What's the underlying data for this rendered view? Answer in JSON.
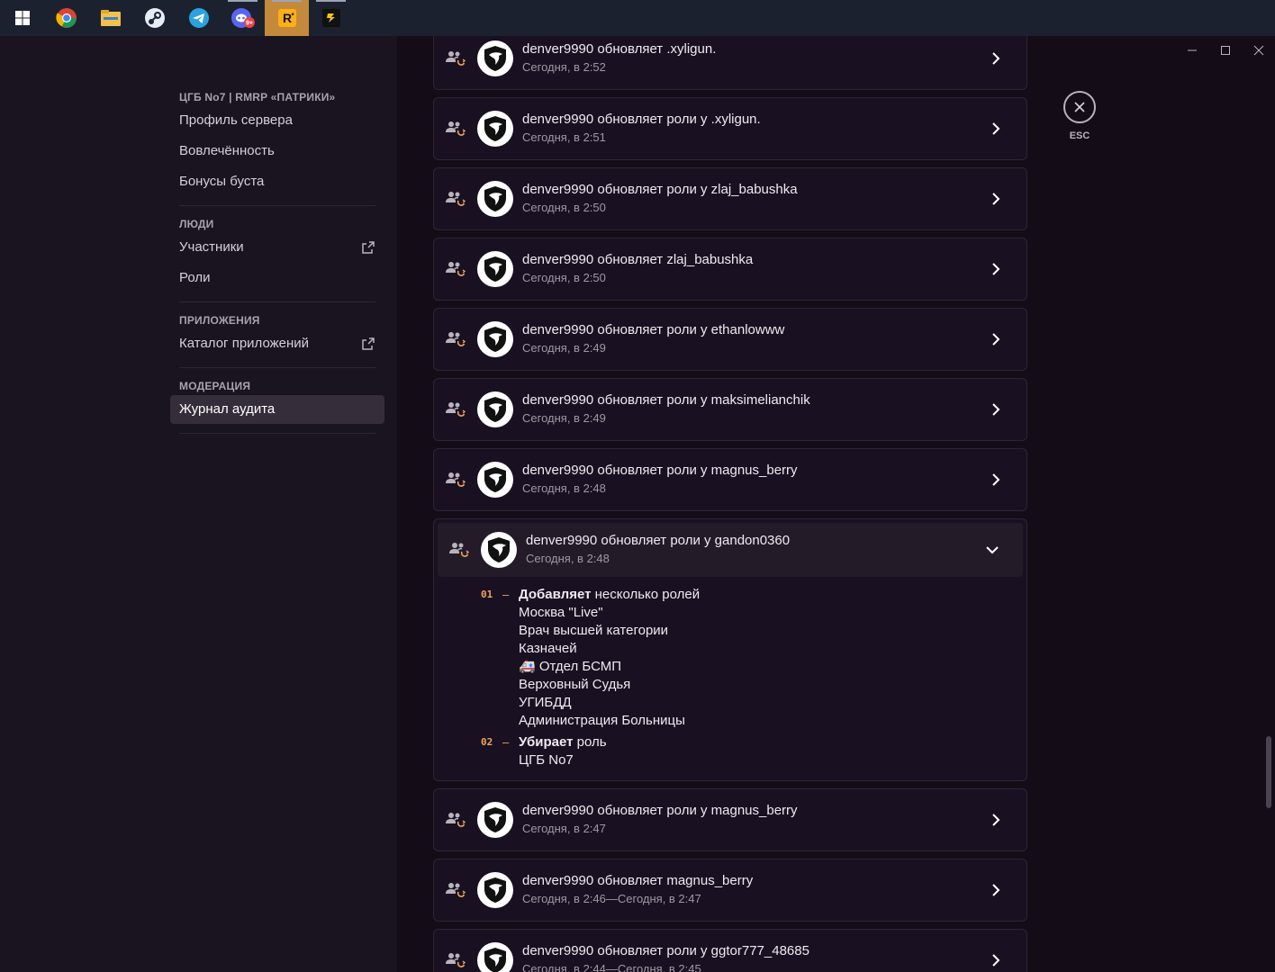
{
  "taskbar": {
    "icons": [
      "windows-start-icon",
      "chrome-icon",
      "file-explorer-icon",
      "steam-icon",
      "telegram-icon",
      "discord-icon",
      "rockstar-launcher-icon",
      "rage-mp-icon"
    ],
    "discord_badge": "9+"
  },
  "window": {
    "minimize": "—",
    "maximize": "☐",
    "close": "✕"
  },
  "sidebar": {
    "server_header": "ЦГБ No7 | RMRP «ПАТРИКИ»",
    "server_items": [
      "Профиль сервера",
      "Вовлечённость",
      "Бонусы буста"
    ],
    "people_header": "ЛЮДИ",
    "people_items": [
      "Участники",
      "Роли"
    ],
    "apps_header": "ПРИЛОЖЕНИЯ",
    "apps_items": [
      "Каталог приложений"
    ],
    "moderation_header": "МОДЕРАЦИЯ",
    "moderation_items": [
      "Журнал аудита"
    ]
  },
  "esc": {
    "label": "ESC"
  },
  "entries": [
    {
      "title": "denver9990 обновляет .xyligun.",
      "time": "Сегодня, в 2:52"
    },
    {
      "title": "denver9990 обновляет роли у .xyligun.",
      "time": "Сегодня, в 2:51"
    },
    {
      "title": "denver9990 обновляет роли у zlaj_babushka",
      "time": "Сегодня, в 2:50"
    },
    {
      "title": "denver9990 обновляет zlaj_babushka",
      "time": "Сегодня, в 2:50"
    },
    {
      "title": "denver9990 обновляет роли у ethanlowww",
      "time": "Сегодня, в 2:49"
    },
    {
      "title": "denver9990 обновляет роли у maksimelianchik",
      "time": "Сегодня, в 2:49"
    },
    {
      "title": "denver9990 обновляет роли у magnus_berry",
      "time": "Сегодня, в 2:48"
    }
  ],
  "expanded": {
    "title": "denver9990 обновляет роли у gandon0360",
    "time": "Сегодня, в 2:48",
    "changes": [
      {
        "num": "01",
        "dash": "–",
        "verb": "Добавляет",
        "rest": " несколько ролей",
        "roles": [
          "Москва \"Live\"",
          "Врач высшей категории",
          "Казначей",
          "🚑 Отдел БСМП",
          "Верховный Судья",
          "УГИБДД",
          "Администрация Больницы"
        ]
      },
      {
        "num": "02",
        "dash": "–",
        "verb": "Убирает",
        "rest": " роль",
        "roles": [
          "ЦГБ No7"
        ]
      }
    ]
  },
  "entries_after": [
    {
      "title": "denver9990 обновляет роли у magnus_berry",
      "time": "Сегодня, в 2:47"
    },
    {
      "title": "denver9990 обновляет magnus_berry",
      "time": "Сегодня, в 2:46—Сегодня, в 2:47"
    },
    {
      "title": "denver9990 обновляет роли у ggtor777_48685",
      "time": "Сегодня, в 2:44—Сегодня, в 2:45"
    }
  ],
  "colors": {
    "accent_number": "#f0a35e",
    "sidebar_bg": "#1a1320",
    "content_bg": "#140d17"
  }
}
